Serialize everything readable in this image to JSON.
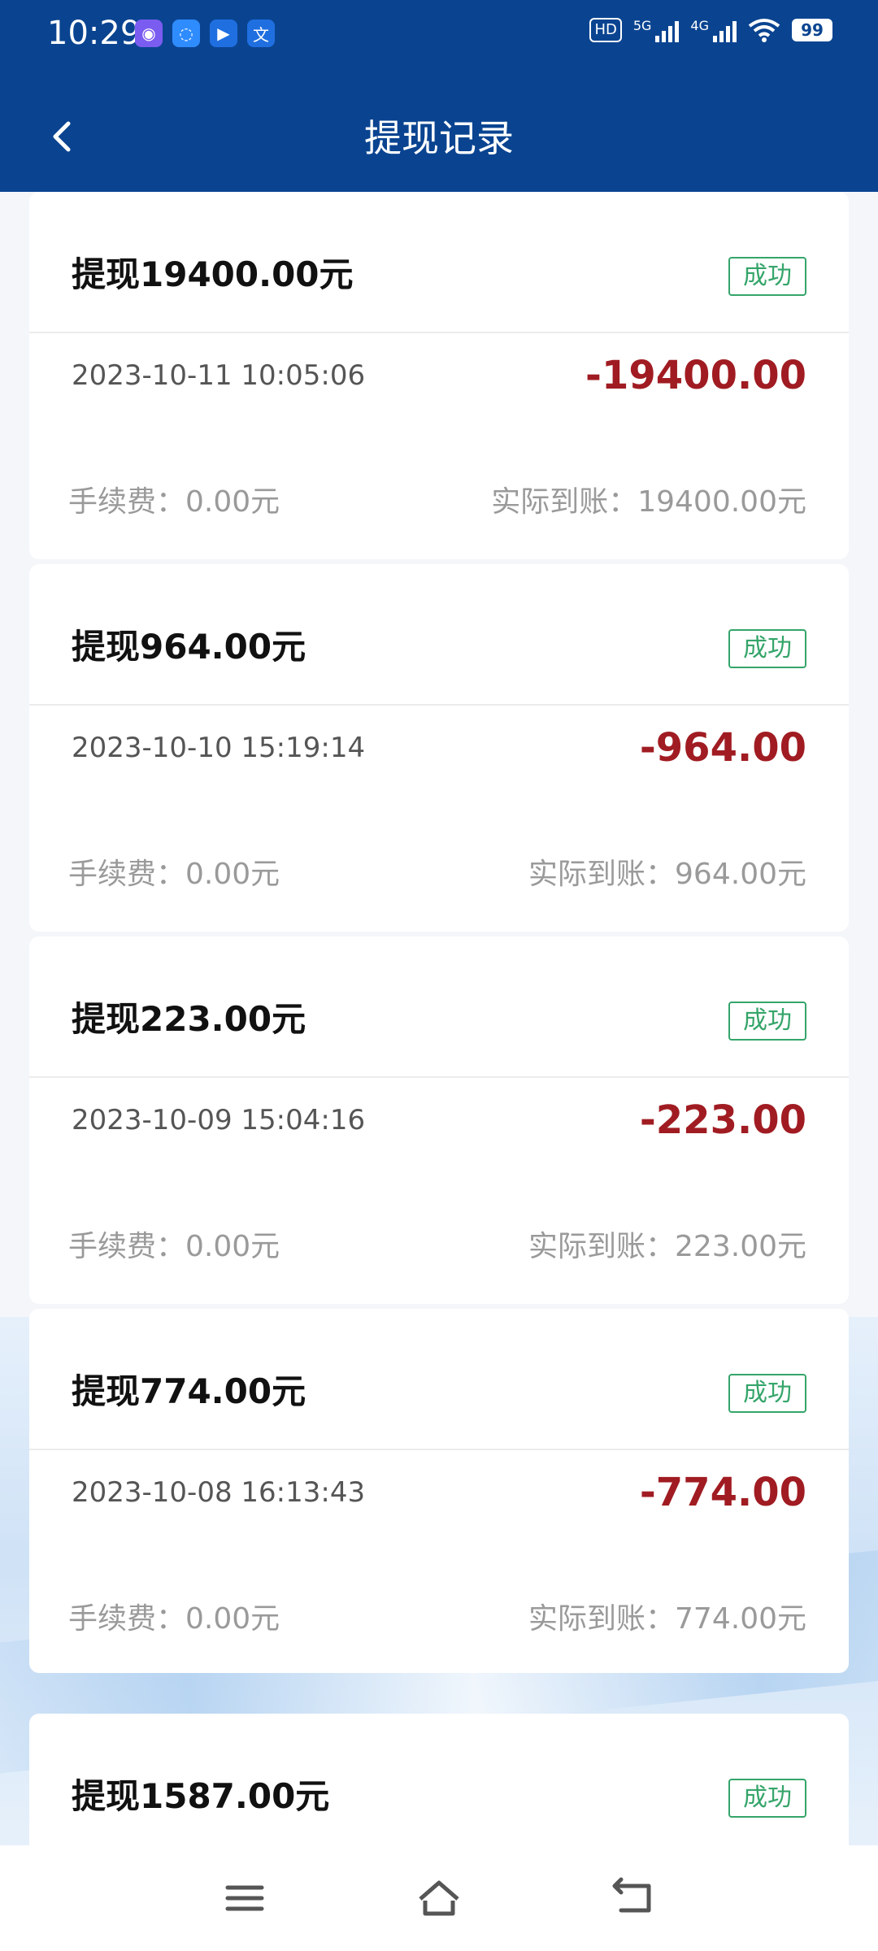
{
  "status_bar": {
    "time": "10:29",
    "notif_icons": [
      {
        "name": "app-icon",
        "color": "#7b5cf0",
        "glyph": "◉"
      },
      {
        "name": "chat-icon",
        "color": "#2f8cff",
        "glyph": "◌"
      },
      {
        "name": "play-icon",
        "color": "#1f6fe0",
        "glyph": "▶"
      },
      {
        "name": "translate-icon",
        "color": "#1f6fe0",
        "glyph": "文"
      }
    ],
    "hd": "HD",
    "sig1_label": "5G",
    "sig2_label": "4G",
    "battery": "99"
  },
  "header": {
    "title": "提现记录"
  },
  "records": [
    {
      "title": "提现19400.00元",
      "status": "成功",
      "time": "2023-10-11 10:05:06",
      "amount": "-19400.00",
      "fee": "手续费：0.00元",
      "actual": "实际到账：19400.00元"
    },
    {
      "title": "提现964.00元",
      "status": "成功",
      "time": "2023-10-10 15:19:14",
      "amount": "-964.00",
      "fee": "手续费：0.00元",
      "actual": "实际到账：964.00元"
    },
    {
      "title": "提现223.00元",
      "status": "成功",
      "time": "2023-10-09 15:04:16",
      "amount": "-223.00",
      "fee": "手续费：0.00元",
      "actual": "实际到账：223.00元"
    },
    {
      "title": "提现774.00元",
      "status": "成功",
      "time": "2023-10-08 16:13:43",
      "amount": "-774.00",
      "fee": "手续费：0.00元",
      "actual": "实际到账：774.00元"
    },
    {
      "title": "提现1587.00元",
      "status": "成功"
    }
  ],
  "colors": {
    "header_bg": "#0a4491",
    "success": "#35a56a",
    "amount": "#a01c22"
  }
}
